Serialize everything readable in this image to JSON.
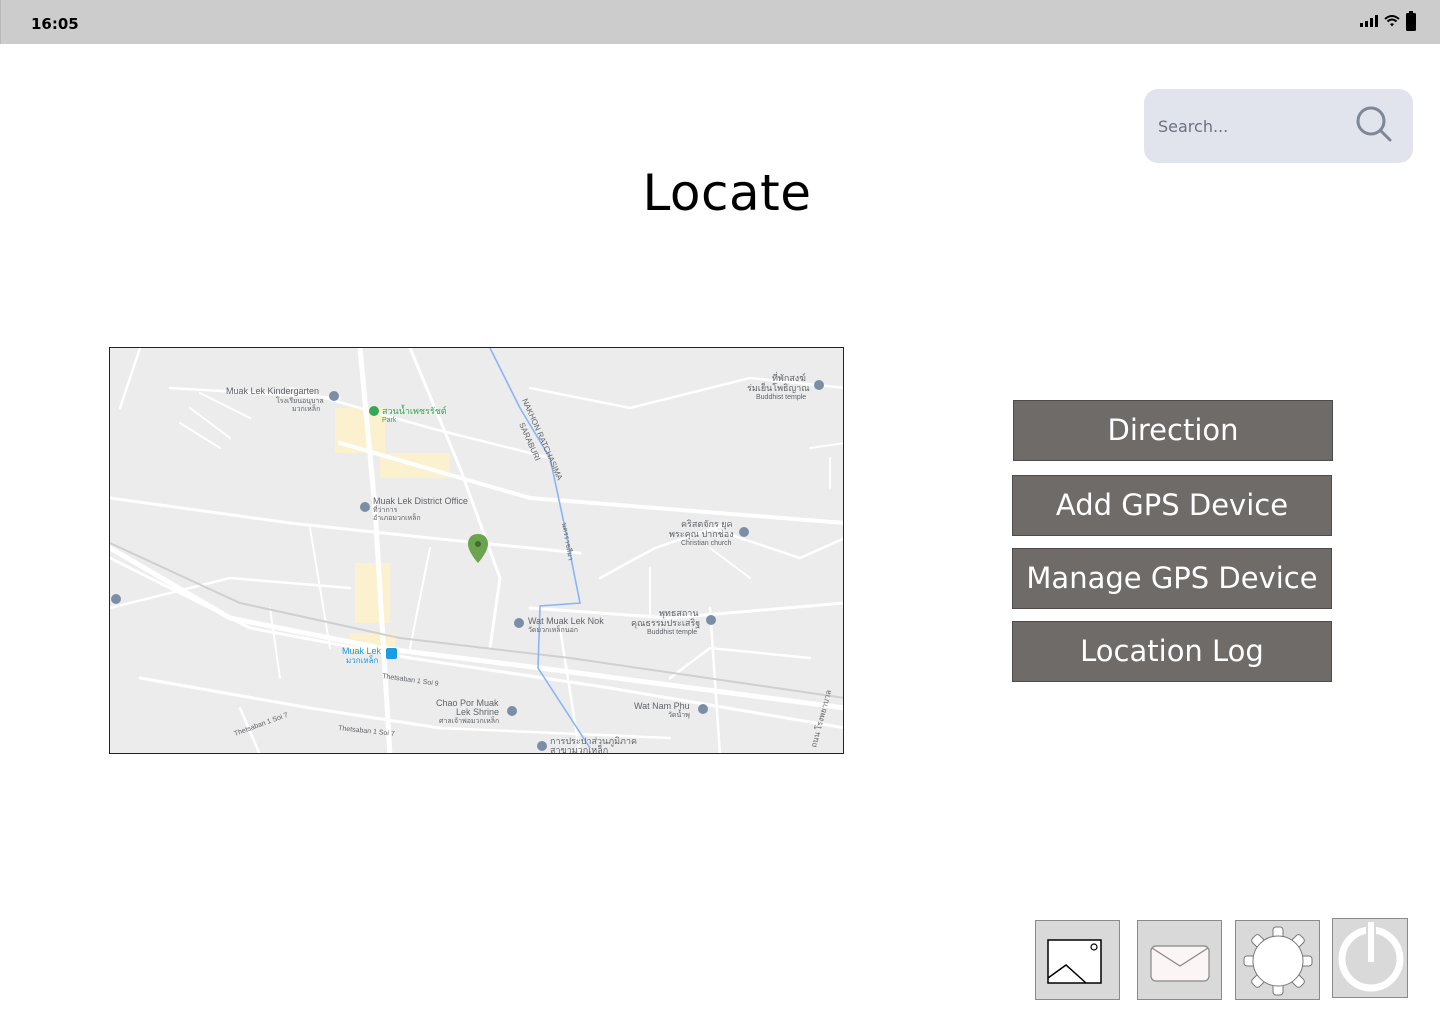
{
  "status_bar": {
    "time": "16:05",
    "icons": [
      "signal-icon",
      "wifi-icon",
      "battery-icon"
    ]
  },
  "search": {
    "placeholder": "Search..."
  },
  "page": {
    "title": "Locate"
  },
  "map": {
    "labels": {
      "kindergarten": "Muak Lek Kindergarten",
      "kindergarten_th1": "โรงเรียนอนุบาล",
      "kindergarten_th2": "มวกเหล็ก",
      "park_th": "สวนน้ำเพชรรัชต์",
      "park": "Park",
      "district_office": "Muak Lek District Office",
      "district_th1": "ที่ว่าการ",
      "district_th2": "อำเภอมวกเหล็ก",
      "road1": "NAKHON RATCHASIMA",
      "road2": "SARABURI",
      "road3": "นครราชสีมา",
      "temple_ne_th1": "ที่พักสงฆ์",
      "temple_ne_th2": "ร่มเย็นโพธิญาณ",
      "temple_ne": "Buddhist temple",
      "church_th1": "คริสตจักร ยุค",
      "church_th2": "พระคุณ ปากช่อง",
      "church": "Christian church",
      "wat_nok": "Wat Muak Lek Nok",
      "wat_nok_th": "วัดมวกเหล็กนอก",
      "bud_th1": "พุทธสถาน",
      "bud_th2": "คุณธรรมประเสริฐ",
      "bud": "Buddhist temple",
      "station": "Muak Lek",
      "station_th": "มวกเหล็ก",
      "soi9": "Thetsaban 1 Soi 9",
      "soi7a": "Thetsaban 1 Soi 7",
      "soi7b": "Thetsaban 1 Soi 7",
      "shrine1": "Chao Por Muak",
      "shrine2": "Lek Shrine",
      "shrine_th": "ศาลเจ้าพ่อมวกเหล็ก",
      "wat_nam": "Wat Nam Phu",
      "wat_nam_th": "วัดน้ำพุ",
      "bottom_th1": "การประปาส่วนภูมิภาค",
      "bottom_th2": "สาขามวกเหล็ก",
      "right_road": "ถนน โรงพยาบาล"
    },
    "colors": {
      "background": "#ececec",
      "road": "#ffffff",
      "water": "#8ab4f8",
      "pin": "#6ba34f",
      "poi": "#7b8ea8",
      "builtup": "#fbf1cf"
    }
  },
  "actions": [
    {
      "label": "Direction"
    },
    {
      "label": "Add GPS Device"
    },
    {
      "label": "Manage GPS Device"
    },
    {
      "label": "Location Log"
    }
  ],
  "dock": {
    "items": [
      "image-icon",
      "mail-icon",
      "settings-gear-icon",
      "power-icon"
    ]
  }
}
